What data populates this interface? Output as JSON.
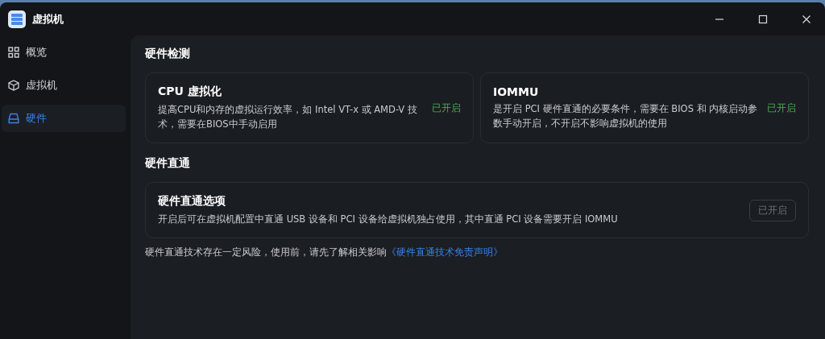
{
  "window": {
    "title": "虚拟机"
  },
  "sidebar": {
    "items": [
      {
        "label": "概览",
        "selected": false
      },
      {
        "label": "虚拟机",
        "selected": false
      },
      {
        "label": "硬件",
        "selected": true
      }
    ]
  },
  "detection": {
    "title": "硬件检测",
    "cards": [
      {
        "title": "CPU 虚拟化",
        "description": "提高CPU和内存的虚拟运行效率，如 Intel VT-x 或 AMD-V 技术，需要在BIOS中手动启用",
        "status": "已开启"
      },
      {
        "title": "IOMMU",
        "description": "是开启 PCI 硬件直通的必要条件，需要在 BIOS 和 内核启动参数手动开启，不开启不影响虚拟机的使用",
        "status": "已开启"
      }
    ]
  },
  "passthrough": {
    "title": "硬件直通",
    "option": {
      "title": "硬件直通选项",
      "description": "开启后可在虚拟机配置中直通 USB 设备和 PCI 设备给虚拟机独占使用，其中直通 PCI 设备需要开启 IOMMU",
      "button": {
        "label": "已开启",
        "disabled": true
      }
    },
    "notice": "硬件直通技术存在一定风险，使用前，请先了解相关影响",
    "link": "《硬件直通技术免责声明》"
  }
}
